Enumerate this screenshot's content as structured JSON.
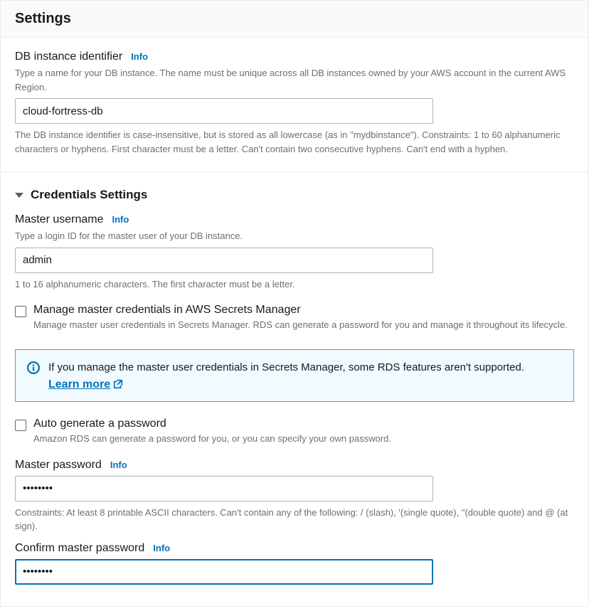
{
  "header": {
    "title": "Settings"
  },
  "db_identifier": {
    "label": "DB instance identifier",
    "info": "Info",
    "desc": "Type a name for your DB instance. The name must be unique across all DB instances owned by your AWS account in the current AWS Region.",
    "value": "cloud-fortress-db",
    "hint": "The DB instance identifier is case-insensitive, but is stored as all lowercase (as in \"mydbinstance\"). Constraints: 1 to 60 alphanumeric characters or hyphens. First character must be a letter. Can't contain two consecutive hyphens. Can't end with a hyphen."
  },
  "credentials": {
    "section_title": "Credentials Settings",
    "username": {
      "label": "Master username",
      "info": "Info",
      "desc": "Type a login ID for the master user of your DB instance.",
      "value": "admin",
      "hint": "1 to 16 alphanumeric characters. The first character must be a letter."
    },
    "secrets_manager": {
      "label": "Manage master credentials in AWS Secrets Manager",
      "desc": "Manage master user credentials in Secrets Manager. RDS can generate a password for you and manage it throughout its lifecycle."
    },
    "alert": {
      "text": "If you manage the master user credentials in Secrets Manager, some RDS features aren't supported.",
      "learn_more": "Learn more"
    },
    "auto_generate": {
      "label": "Auto generate a password",
      "desc": "Amazon RDS can generate a password for you, or you can specify your own password."
    },
    "password": {
      "label": "Master password",
      "info": "Info",
      "value": "••••••••",
      "hint": "Constraints: At least 8 printable ASCII characters. Can't contain any of the following: / (slash), '(single quote), \"(double quote) and @ (at sign)."
    },
    "confirm_password": {
      "label": "Confirm master password",
      "info": "Info",
      "value": "••••••••"
    }
  }
}
